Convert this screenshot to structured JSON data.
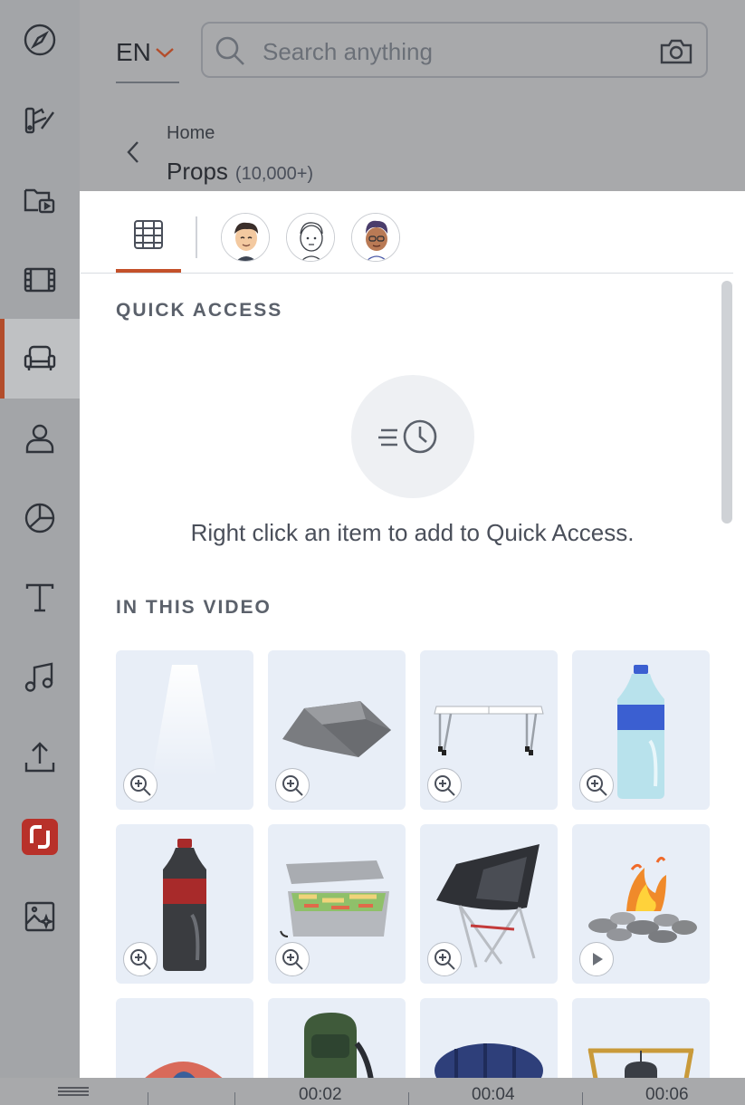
{
  "header": {
    "language": "EN",
    "search_placeholder": "Search anything",
    "breadcrumb_home": "Home",
    "title": "Props",
    "count": "(10,000+)"
  },
  "sidebar": {
    "items": [
      {
        "icon": "compass-icon"
      },
      {
        "icon": "palette-brush-icon"
      },
      {
        "icon": "video-folder-icon"
      },
      {
        "icon": "film-strip-icon"
      },
      {
        "icon": "armchair-props-icon",
        "active": true
      },
      {
        "icon": "person-icon"
      },
      {
        "icon": "pie-chart-icon"
      },
      {
        "icon": "text-icon"
      },
      {
        "icon": "music-note-icon"
      },
      {
        "icon": "upload-icon"
      },
      {
        "icon": "app-logo-icon"
      },
      {
        "icon": "ai-image-icon"
      }
    ],
    "accent_color": "#b34d2b"
  },
  "panel": {
    "tabs": [
      {
        "icon": "grid-icon",
        "active": true
      },
      {
        "icon": "avatar-character-1"
      },
      {
        "icon": "avatar-character-2"
      },
      {
        "icon": "avatar-character-3"
      }
    ],
    "quick_access_title": "QUICK ACCESS",
    "quick_access_hint": "Right click an item to add to Quick Access.",
    "in_video_title": "IN THIS VIDEO",
    "items": [
      {
        "name": "spotlight",
        "badge": "zoom-icon"
      },
      {
        "name": "rock",
        "badge": "zoom-icon"
      },
      {
        "name": "folding-table",
        "badge": "zoom-icon"
      },
      {
        "name": "water-bottle",
        "badge": "zoom-icon"
      },
      {
        "name": "cola-bottle",
        "badge": "zoom-icon"
      },
      {
        "name": "lunch-box",
        "badge": "zoom-icon"
      },
      {
        "name": "camping-chair",
        "badge": "zoom-icon"
      },
      {
        "name": "campfire",
        "badge": "play-icon"
      },
      {
        "name": "tent",
        "badge": ""
      },
      {
        "name": "backpack",
        "badge": ""
      },
      {
        "name": "sleeping-bag",
        "badge": ""
      },
      {
        "name": "campfire-pot",
        "badge": ""
      }
    ]
  },
  "timeline": {
    "labels": [
      "00:02",
      "00:04",
      "00:06"
    ]
  }
}
